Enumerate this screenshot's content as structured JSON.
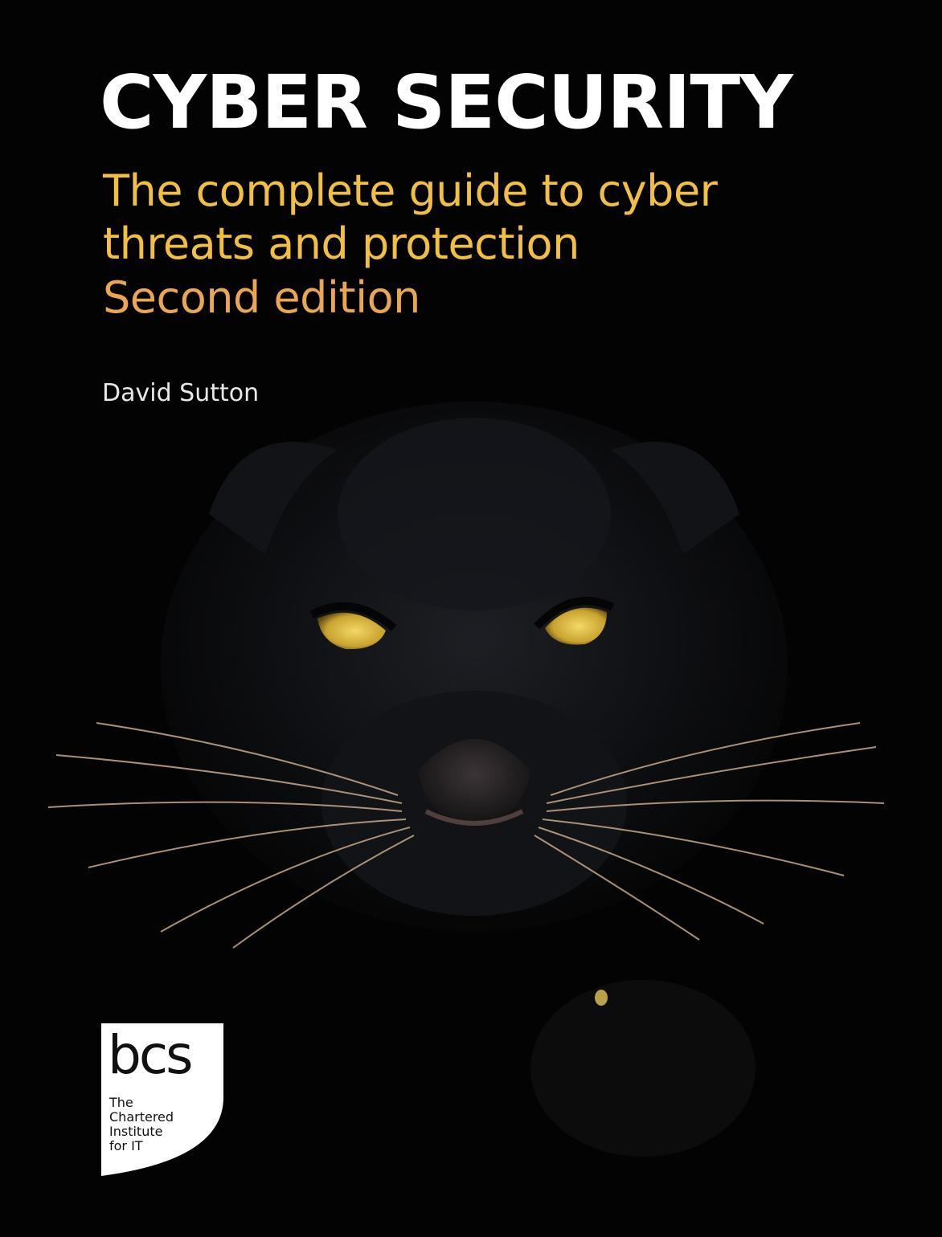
{
  "cover": {
    "title": "CYBER SECURITY",
    "subtitle_line1": "The complete guide to cyber",
    "subtitle_line2": "threats and protection",
    "edition": "Second edition",
    "author": "David Sutton"
  },
  "logo": {
    "wordmark": "bcs",
    "tag_line1": "The",
    "tag_line2": "Chartered",
    "tag_line3": "Institute",
    "tag_line4": "for IT"
  },
  "image": {
    "subject": "black-panther-face"
  },
  "colors": {
    "background": "#030303",
    "title": "#ffffff",
    "subtitle": "#f1bf42",
    "edition": "#e9a653",
    "eyes": "#d9b83a"
  }
}
